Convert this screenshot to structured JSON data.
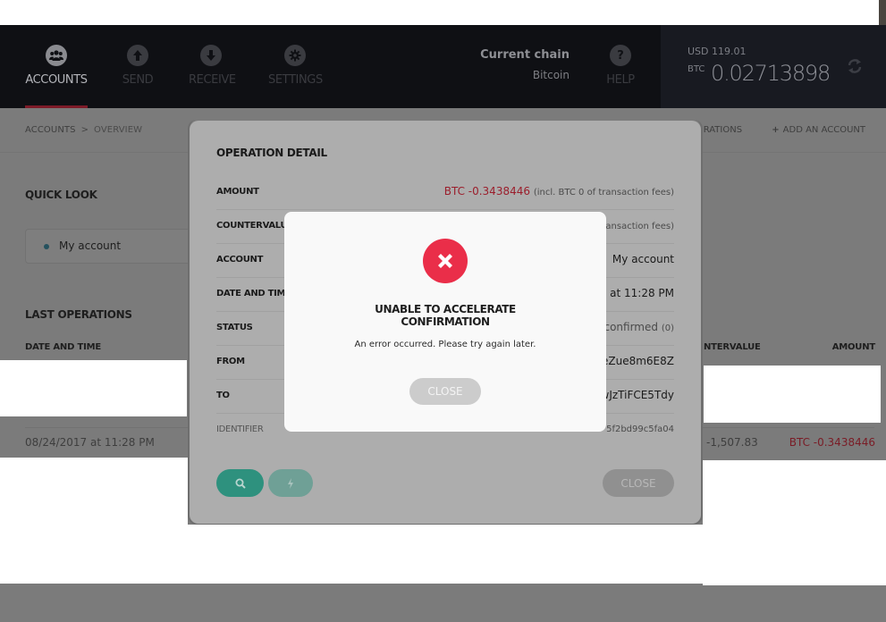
{
  "header": {
    "nav": [
      {
        "label": "ACCOUNTS",
        "icon": "accounts-icon",
        "active": true
      },
      {
        "label": "SEND",
        "icon": "send-icon",
        "active": false
      },
      {
        "label": "RECEIVE",
        "icon": "receive-icon",
        "active": false
      },
      {
        "label": "SETTINGS",
        "icon": "settings-icon",
        "active": false
      }
    ],
    "chain": {
      "title": "Current chain",
      "value": "Bitcoin"
    },
    "help": {
      "label": "HELP",
      "icon": "help-icon"
    },
    "balance": {
      "usd": "USD 119.01",
      "btc_label": "BTC",
      "btc_value": "0.02713898"
    },
    "refresh_icon": "refresh-icon"
  },
  "breadcrumb": {
    "root": "ACCOUNTS",
    "separator": ">",
    "current": "OVERVIEW"
  },
  "top_actions": {
    "operations": "RATIONS",
    "add_account": "ADD AN ACCOUNT"
  },
  "quick_look": {
    "title": "QUICK LOOK",
    "account": "My account"
  },
  "last_operations": {
    "title": "LAST OPERATIONS",
    "columns": {
      "date": "DATE AND TIME",
      "countervalue": "NTERVALUE",
      "amount": "AMOUNT"
    },
    "rows": [
      {
        "date": "08/24/2017 at 11:28 PM",
        "countervalue": "-1,507.83",
        "amount": "BTC -0.3438446"
      }
    ]
  },
  "operation_detail": {
    "title": "OPERATION DETAIL",
    "rows": [
      {
        "label": "AMOUNT",
        "value": "BTC -0.3438446",
        "note": "(incl. BTC 0 of transaction fees)"
      },
      {
        "label": "COUNTERVALU",
        "value": "",
        "note": "ansaction fees)"
      },
      {
        "label": "ACCOUNT",
        "value": "My account"
      },
      {
        "label": "DATE AND TIMI",
        "value": "at 11:28 PM"
      },
      {
        "label": "STATUS",
        "value": "confirmed",
        "note": "(0)"
      },
      {
        "label": "FROM",
        "value": "eZue8m6E8Z"
      },
      {
        "label": "TO",
        "value": "wJzTiFCE5Tdy"
      },
      {
        "label": "IDENTIFIER",
        "value": "5f2bd99c5fa04"
      }
    ],
    "buttons": {
      "search_icon": "search-icon",
      "accelerate_icon": "bolt-icon",
      "close": "CLOSE"
    }
  },
  "error_dialog": {
    "icon": "error-x-icon",
    "title_line1": "UNABLE TO ACCELERATE",
    "title_line2": "CONFIRMATION",
    "message": "An error occurred. Please try again later.",
    "close": "CLOSE"
  }
}
